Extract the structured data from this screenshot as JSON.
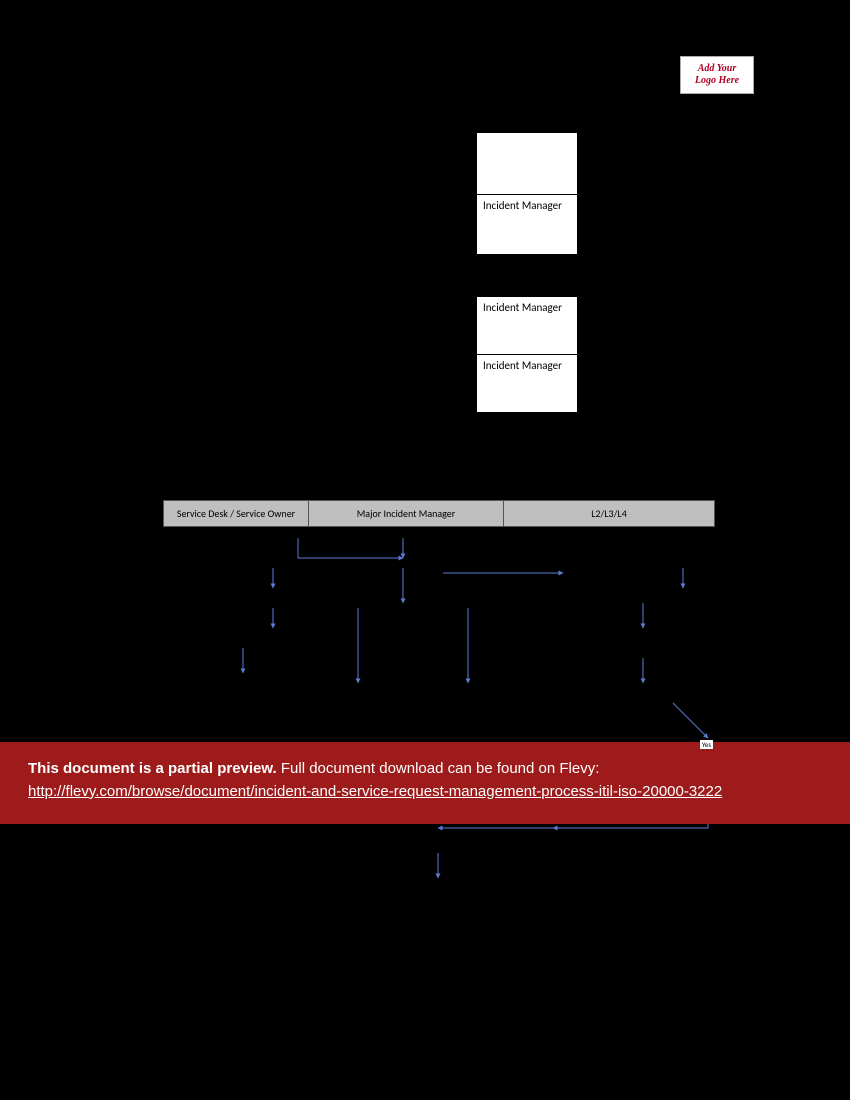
{
  "logo": {
    "line1": "Add Your",
    "line2": "Logo Here"
  },
  "roleTable1": {
    "row1": "",
    "row2": "Incident Manager"
  },
  "roleTable2": {
    "row1": "Incident Manager",
    "row2": "Incident Manager"
  },
  "swimlanes": {
    "col1": "Service Desk / Service Owner",
    "col2": "Major Incident Manager",
    "col3": "L2/L3/L4"
  },
  "flowLabels": {
    "yes": "Yes"
  },
  "banner": {
    "bold": "This document is a partial preview.",
    "rest": "  Full document download can be found on Flevy:",
    "url": "http://flevy.com/browse/document/incident-and-service-request-management-process-itil-iso-20000-3222"
  }
}
